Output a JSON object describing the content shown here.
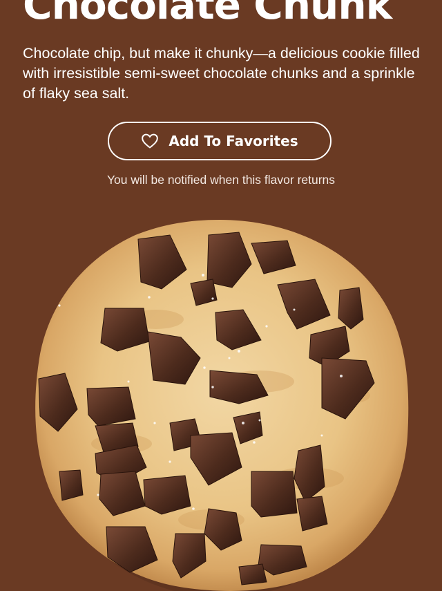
{
  "product": {
    "title": "Chocolate Chunk",
    "description": "Chocolate chip, but make it chunky—a delicious cookie filled with irresistible semi-sweet chocolate chunks and a sprinkle of flaky sea salt.",
    "favorite_button_label": "Add To Favorites",
    "favorite_icon": "heart-outline-icon",
    "notify_text": "You will be notified when this flavor returns"
  },
  "colors": {
    "background": "#6a3a23",
    "text": "#ffffff",
    "button_border": "#ffffff"
  }
}
